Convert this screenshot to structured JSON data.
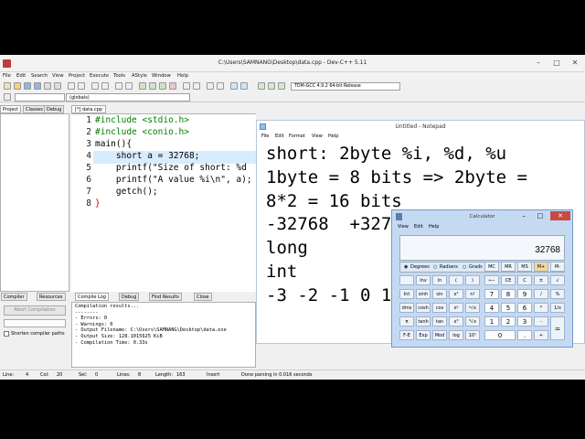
{
  "ide": {
    "title": "C:\\Users\\SAMNANG\\Desktop\\data.cpp - Dev-C++ 5.11",
    "menu": [
      "File",
      "Edit",
      "Search",
      "View",
      "Project",
      "Execute",
      "Tools",
      "AStyle",
      "Window",
      "Help"
    ],
    "compiler": "TDM-GCC 4.9.2 64-bit Release",
    "scope": "(globals)",
    "left_tabs": [
      "Project",
      "Classes",
      "Debug"
    ],
    "editor_tab": "[*] data.cpp",
    "code": [
      {
        "n": "1",
        "t": "#include <stdio.h>"
      },
      {
        "n": "2",
        "t": "#include <conio.h>"
      },
      {
        "n": "3",
        "t": "main(){"
      },
      {
        "n": "4",
        "t": "    short a = 32768;"
      },
      {
        "n": "5",
        "t": "    printf(\"Size of short: %d"
      },
      {
        "n": "6",
        "t": "    printf(\"A value %i\\n\", a);"
      },
      {
        "n": "7",
        "t": "    getch();"
      },
      {
        "n": "8",
        "t": "}"
      }
    ],
    "bottom_tabs": [
      "Compiler",
      "Resources",
      "Compile Log",
      "Debug",
      "Find Results",
      "Close"
    ],
    "abort_label": "Abort Compilation",
    "shorten_label": "Shorten compiler paths",
    "log": [
      "Compilation results...",
      "--------",
      "- Errors: 0",
      "- Warnings: 0",
      "- Output Filename: C:\\Users\\SAMNANG\\Desktop\\data.exe",
      "- Output Size: 128.1015625 KiB",
      "- Compilation Time: 0.33s"
    ],
    "status": {
      "line_label": "Line:",
      "line": "4",
      "col_label": "Col:",
      "col": "20",
      "sel_label": "Sel:",
      "sel": "0",
      "lines_label": "Lines:",
      "lines": "8",
      "length_label": "Length:",
      "length": "163",
      "mode": "Insert",
      "msg": "Done parsing in 0.016 seconds"
    }
  },
  "notepad": {
    "title": "Untitled - Notepad",
    "menu": [
      "File",
      "Edit",
      "Format",
      "View",
      "Help"
    ],
    "lines": [
      "short: 2byte %i, %d, %u",
      "1byte = 8 bits => 2byte =",
      "8*2 = 16 bits",
      "-32768  +327",
      "long",
      "int",
      "-3 -2 -1 0 1"
    ]
  },
  "calculator": {
    "title": "Calculator",
    "menu": [
      "View",
      "Edit",
      "Help"
    ],
    "display": "32768",
    "modes": [
      "Degrees",
      "Radians",
      "Grads"
    ],
    "rows": [
      [
        "",
        "Inv",
        "ln",
        "(",
        ")",
        "⟵",
        "CE",
        "C",
        "±",
        "√"
      ],
      [
        "Int",
        "sinh",
        "sin",
        "x²",
        "n!",
        "7",
        "8",
        "9",
        "/",
        "%"
      ],
      [
        "dms",
        "cosh",
        "cos",
        "xʸ",
        "ʸ√x",
        "4",
        "5",
        "6",
        "*",
        "1/x"
      ],
      [
        "π",
        "tanh",
        "tan",
        "x³",
        "³√x",
        "1",
        "2",
        "3",
        "-",
        "="
      ],
      [
        "F-E",
        "Exp",
        "Mod",
        "log",
        "10ˣ",
        "0",
        ".",
        "+"
      ]
    ],
    "mem": [
      "MC",
      "MR",
      "MS",
      "M+",
      "M-"
    ]
  }
}
